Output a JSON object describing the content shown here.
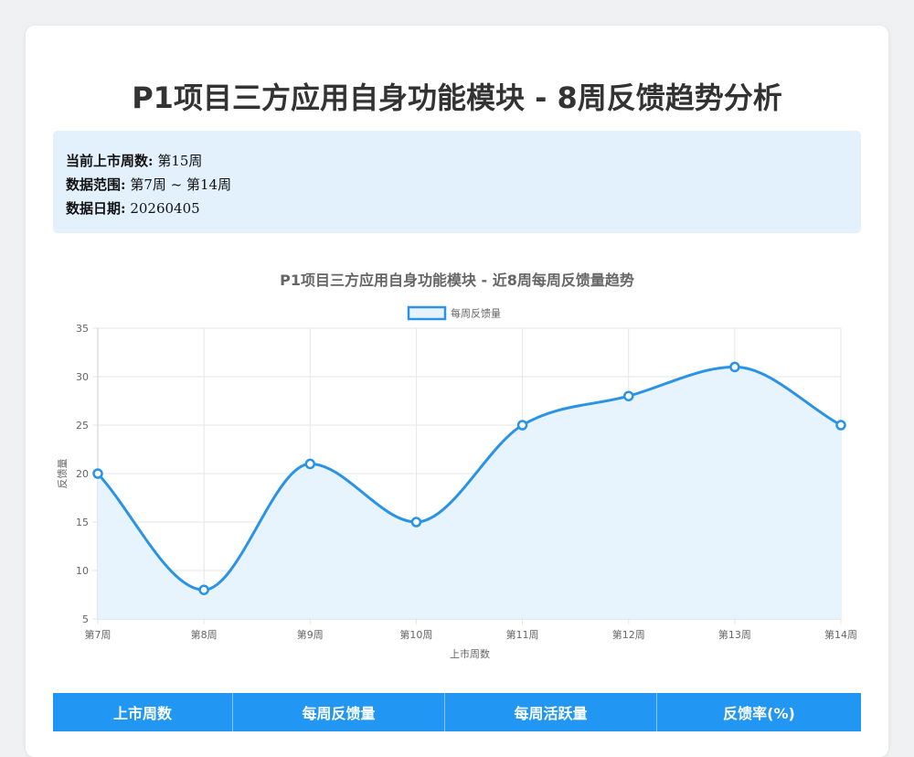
{
  "page": {
    "title": "P1项目三方应用自身功能模块 - 8周反馈趋势分析"
  },
  "info": {
    "launch_week_label": "当前上市周数:",
    "launch_week_value": "第15周",
    "range_label": "数据范围:",
    "range_value": "第7周 ~ 第14周",
    "date_label": "数据日期:",
    "date_value": "20260405"
  },
  "colors": {
    "accent": "#2196f3",
    "line": "#2a93e6",
    "fill": "#e6f3fd",
    "info_bg": "#e3f1fd"
  },
  "chart_data": {
    "type": "line",
    "title": "P1项目三方应用自身功能模块 - 近8周每周反馈量趋势",
    "categories": [
      "第7周",
      "第8周",
      "第9周",
      "第10周",
      "第11周",
      "第12周",
      "第13周",
      "第14周"
    ],
    "series": [
      {
        "name": "每周反馈量",
        "values": [
          20,
          8,
          21,
          15,
          25,
          28,
          31,
          25
        ]
      }
    ],
    "xlabel": "上市周数",
    "ylabel": "反馈量",
    "ylim": [
      5,
      35
    ],
    "yticks": [
      5,
      10,
      15,
      20,
      25,
      30,
      35
    ],
    "grid": true,
    "legend": "top-center",
    "filled": true,
    "smooth": true
  },
  "table": {
    "headers": [
      "上市周数",
      "每周反馈量",
      "每周活跃量",
      "反馈率(%)"
    ]
  }
}
